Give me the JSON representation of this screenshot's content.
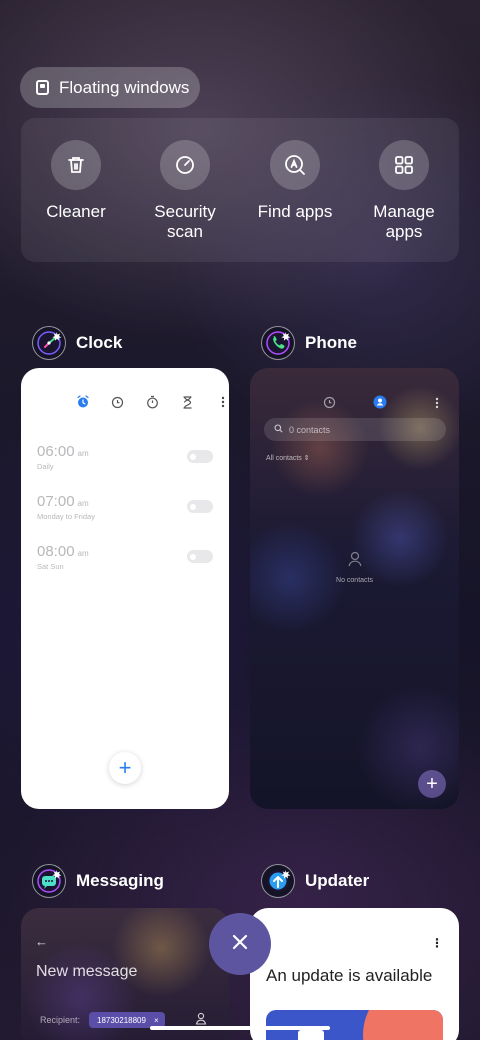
{
  "floating_windows": {
    "label": "Floating windows"
  },
  "tools": [
    {
      "label": "Cleaner",
      "icon": "trash-icon"
    },
    {
      "label": "Security\nscan",
      "icon": "security-scan-icon"
    },
    {
      "label": "Find apps",
      "icon": "find-apps-icon"
    },
    {
      "label": "Manage\napps",
      "icon": "grid-icon"
    }
  ],
  "apps": {
    "clock": {
      "name": "Clock",
      "alarms": [
        {
          "time": "06:00",
          "ampm": "am",
          "repeat": "Daily"
        },
        {
          "time": "07:00",
          "ampm": "am",
          "repeat": "Monday to Friday"
        },
        {
          "time": "08:00",
          "ampm": "am",
          "repeat": "Sat Sun"
        }
      ],
      "add": "+"
    },
    "phone": {
      "name": "Phone",
      "search_placeholder": "0 contacts",
      "filter": "All contacts",
      "empty": "No contacts",
      "add": "+"
    },
    "messaging": {
      "name": "Messaging",
      "back": "←",
      "title": "New message",
      "recipient_label": "Recipient:",
      "recipient_chip": "18730218809",
      "chip_close": "×"
    },
    "updater": {
      "name": "Updater",
      "menu": "⋮",
      "title": "An update is available"
    }
  },
  "colors": {
    "accent": "#5e55a0",
    "clock_accent": "#2a7df0"
  }
}
